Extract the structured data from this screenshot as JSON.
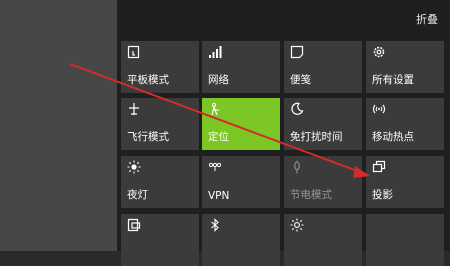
{
  "header": {
    "collapse_label": "折叠"
  },
  "tiles": [
    {
      "label": "平板模式",
      "icon": "tablet-icon"
    },
    {
      "label": "网络",
      "icon": "network-icon"
    },
    {
      "label": "便笺",
      "icon": "note-icon"
    },
    {
      "label": "所有设置",
      "icon": "gear-icon"
    },
    {
      "label": "飞行模式",
      "icon": "airplane-icon"
    },
    {
      "label": "定位",
      "icon": "location-icon",
      "active": true
    },
    {
      "label": "免打扰时间",
      "icon": "moon-icon"
    },
    {
      "label": "移动热点",
      "icon": "hotspot-icon"
    },
    {
      "label": "夜灯",
      "icon": "brightness-icon"
    },
    {
      "label": "VPN",
      "icon": "vpn-icon"
    },
    {
      "label": "节电模式",
      "icon": "battery-saver-icon",
      "disabled": true
    },
    {
      "label": "投影",
      "icon": "project-icon"
    },
    {
      "label": "",
      "icon": "connect-icon"
    },
    {
      "label": "",
      "icon": "bluetooth-icon"
    },
    {
      "label": "",
      "icon": "brightness-icon"
    }
  ],
  "colors": {
    "active_tile": "#7cc626",
    "tile": "#3b3b3b",
    "panel": "#1f1f1f",
    "annotation_arrow": "#d42b2b"
  }
}
